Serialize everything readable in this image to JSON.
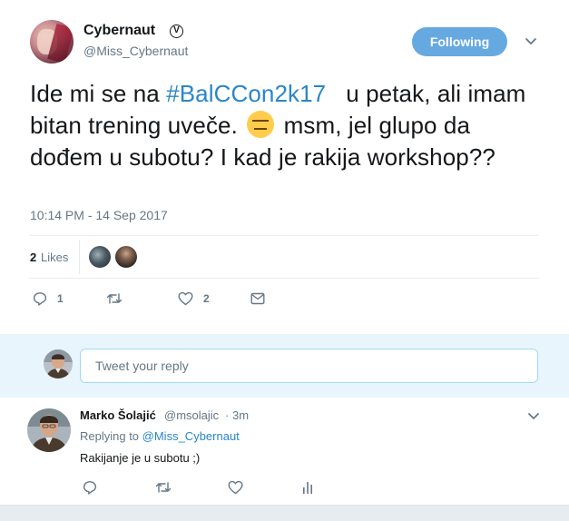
{
  "tweet": {
    "author_name": "Cybernaut",
    "verified_glyph": "Ⓥ",
    "author_handle": "@Miss_Cybernaut",
    "follow_label": "Following",
    "text_before": "Ide mi se na ",
    "hashtag": "#BalCCon2k17",
    "text_mid": "   u petak, ali imam bitan trening uveče. ",
    "emoji_name": "expressionless-face",
    "text_after": " msm, jel glupo da dođem u subotu? I kad je rakija workshop??",
    "timestamp": "10:14 PM - 14 Sep 2017",
    "likes_count": "2",
    "likes_label": "Likes",
    "reply_count": "1",
    "like_count": "2"
  },
  "reply_box": {
    "placeholder": "Tweet your reply"
  },
  "reply": {
    "author_name": "Marko Šolajić",
    "author_handle": "@msolajic",
    "separator": "·",
    "time": "3m",
    "replying_prefix": "Replying to ",
    "replying_to": "@Miss_Cybernaut",
    "text": "Rakijanje je u subotu ;)"
  },
  "colors": {
    "accent": "#2a86c9",
    "follow_button": "#66a9e0",
    "muted": "#657786",
    "reply_bar_bg": "#e8f5fd"
  },
  "icons": [
    "verified-icon",
    "caret-down-icon",
    "reply-icon",
    "retweet-icon",
    "heart-icon",
    "mail-icon",
    "analytics-icon"
  ]
}
